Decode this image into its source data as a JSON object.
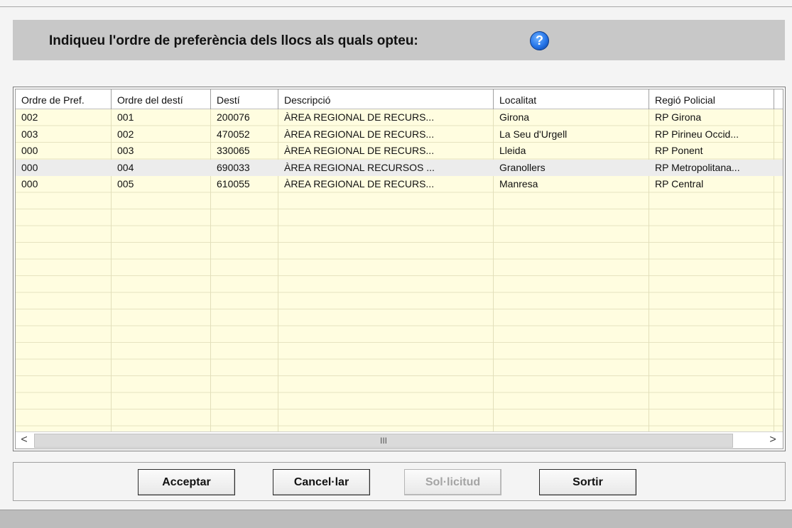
{
  "header": {
    "title": "Indiqueu l'ordre de preferència dels llocs als quals opteu:",
    "help_icon": "question-mark-icon"
  },
  "grid": {
    "columns": [
      "Ordre de Pref.",
      "Ordre del destí",
      "Destí",
      "Descripció",
      "Localitat",
      "Regió Policial"
    ],
    "rows": [
      [
        "002",
        "001",
        "200076",
        "ÀREA REGIONAL DE RECURS...",
        "Girona",
        "RP Girona"
      ],
      [
        "003",
        "002",
        "470052",
        "ÀREA REGIONAL DE RECURS...",
        "La Seu d'Urgell",
        "RP Pirineu Occid..."
      ],
      [
        "000",
        "003",
        "330065",
        "ÀREA REGIONAL DE RECURS...",
        "Lleida",
        "RP Ponent"
      ],
      [
        "000",
        "004",
        "690033",
        "ÀREA REGIONAL RECURSOS ...",
        "Granollers",
        "RP  Metropolitana..."
      ],
      [
        "000",
        "005",
        "610055",
        "ÀREA REGIONAL DE RECURS...",
        "Manresa",
        "RP Central"
      ]
    ],
    "selected_row_index": 3,
    "row_bg_color": "#fffde0",
    "scrollbar": {
      "left_arrow": "<",
      "right_arrow": ">",
      "thumb_grip": "III"
    }
  },
  "buttons": {
    "accept": "Acceptar",
    "cancel": "Cancel·lar",
    "request": "Sol·licitud",
    "exit": "Sortir"
  }
}
